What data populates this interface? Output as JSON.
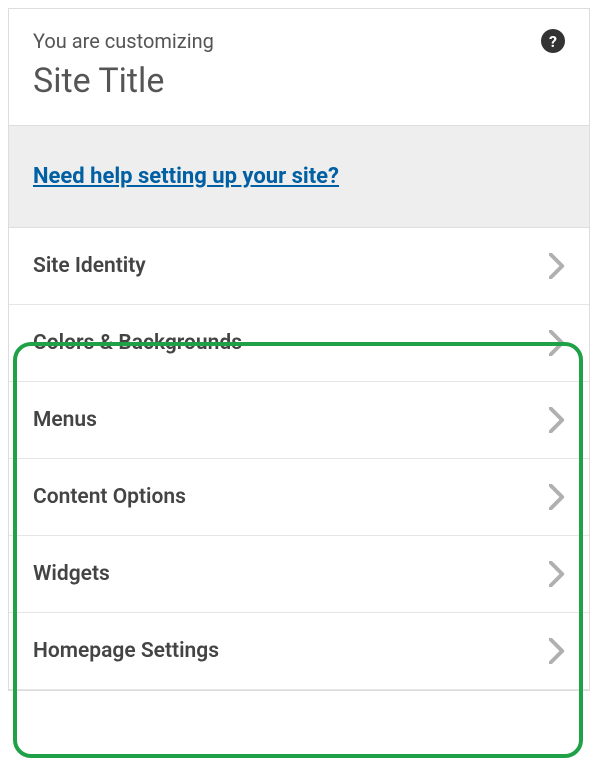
{
  "header": {
    "label": "You are customizing",
    "title": "Site Title",
    "help_icon_char": "?"
  },
  "help_banner": {
    "link_text": "Need help setting up your site?"
  },
  "sections": [
    {
      "key": "site-identity",
      "label": "Site Identity"
    },
    {
      "key": "colors-backgrounds",
      "label": "Colors & Backgrounds"
    },
    {
      "key": "menus",
      "label": "Menus"
    },
    {
      "key": "content-options",
      "label": "Content Options"
    },
    {
      "key": "widgets",
      "label": "Widgets"
    },
    {
      "key": "homepage-settings",
      "label": "Homepage Settings"
    }
  ],
  "highlight": {
    "color": "#1fa147"
  }
}
